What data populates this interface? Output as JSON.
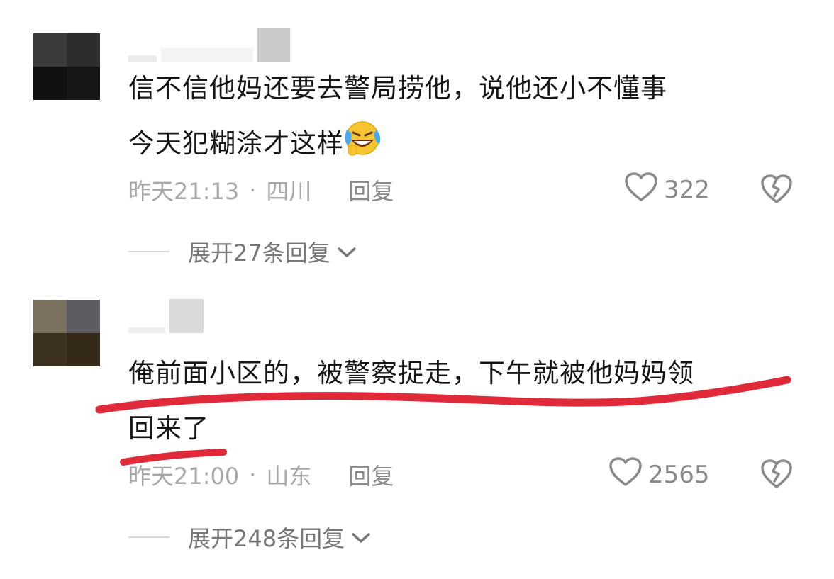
{
  "comments": [
    {
      "text_line1": "信不信他妈还要去警局捞他，说他还小不懂事",
      "text_line2": "今天犯糊涂才这样",
      "emoji": "laughing-crying-emoji",
      "time": "昨天21:13",
      "separator": "·",
      "location": "四川",
      "reply_label": "回复",
      "likes": "322",
      "expand_label": "展开27条回复"
    },
    {
      "text_line1": "俺前面小区的，被警察捉走，下午就被他妈妈领",
      "text_line2": "回来了",
      "time": "昨天21:00",
      "separator": "·",
      "location": "山东",
      "reply_label": "回复",
      "likes": "2565",
      "expand_label": "展开248条回复"
    }
  ],
  "colors": {
    "annotation_red": "#e02a3a",
    "meta_gray": "#a8a8a8"
  },
  "icons": [
    "heart-outline-icon",
    "broken-heart-icon",
    "chevron-down-icon"
  ]
}
